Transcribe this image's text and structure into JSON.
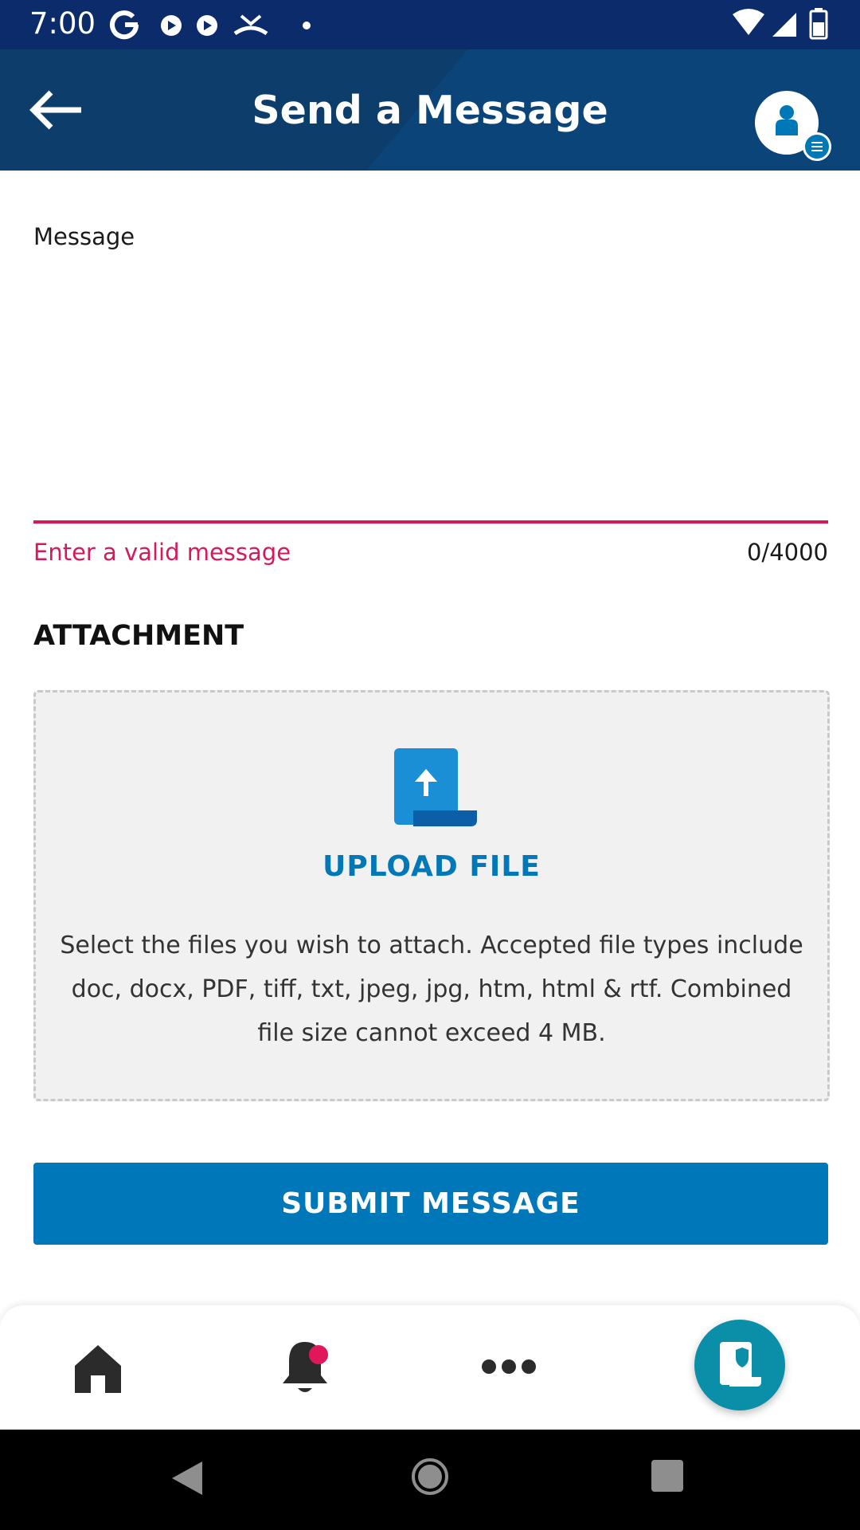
{
  "status_bar": {
    "time": "7:00",
    "left_icons": [
      "google-icon",
      "app-notification-icon",
      "app-notification-icon",
      "missed-call-icon",
      "dot-icon"
    ],
    "right_icons": [
      "wifi-icon",
      "signal-icon",
      "battery-icon"
    ]
  },
  "header": {
    "title": "Send a Message",
    "back_icon": "arrow-left-icon",
    "profile_icon": "user-icon",
    "colors": {
      "background": "#0d3d6b",
      "sheen": "#0a4478"
    }
  },
  "form": {
    "message_label": "Message",
    "message_value": "",
    "error_text": "Enter a valid message",
    "char_counter": "0/4000",
    "error_color": "#d6195b"
  },
  "attachment": {
    "heading": "ATTACHMENT",
    "upload_label": "UPLOAD FILE",
    "upload_icon": "file-upload-icon",
    "help_text": "Select the files you wish to attach. Accepted file types include doc, docx, PDF, tiff, txt, jpeg, jpg, htm, html & rtf. Combined file size cannot exceed 4 MB."
  },
  "submit": {
    "label": "SUBMIT MESSAGE",
    "color": "#0077b9"
  },
  "bottom_nav": {
    "items": [
      "home-icon",
      "bell-icon",
      "more-icon",
      "policy-document-icon"
    ],
    "notification_dot_color": "#e0175a",
    "fab_color": "#0b8ea8"
  },
  "system_nav": {
    "items": [
      "back-triangle-icon",
      "home-circle-icon",
      "recents-square-icon"
    ]
  }
}
